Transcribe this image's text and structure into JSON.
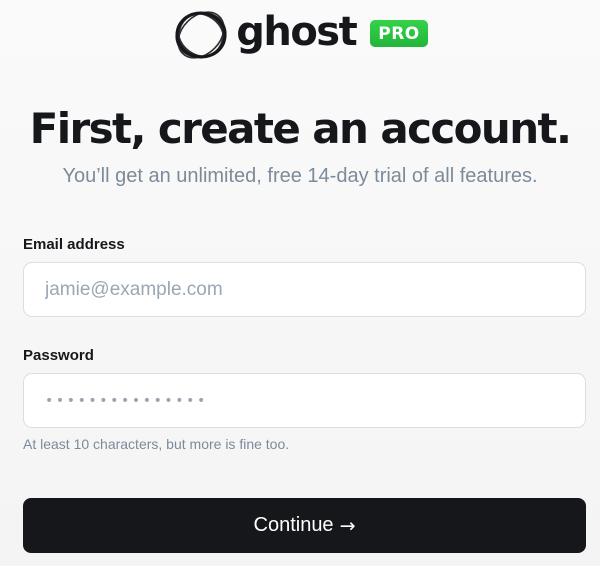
{
  "brand": {
    "wordmark": "ghost",
    "badge": "PRO",
    "badge_color": "#30cf43"
  },
  "header": {
    "title": "First, create an account.",
    "subtitle": "You’ll get an unlimited, free 14-day trial of all features."
  },
  "form": {
    "email": {
      "label": "Email address",
      "placeholder": "jamie@example.com",
      "value": ""
    },
    "password": {
      "label": "Password",
      "masked_value": "•••••••••••••••",
      "hint": "At least 10 characters, but more is fine too."
    },
    "submit": {
      "label": "Continue",
      "icon": "arrow-right-icon",
      "arrow": "→"
    }
  },
  "colors": {
    "text_dark": "#15171a",
    "text_muted": "#7c8b9a",
    "button_bg": "#15171a"
  }
}
